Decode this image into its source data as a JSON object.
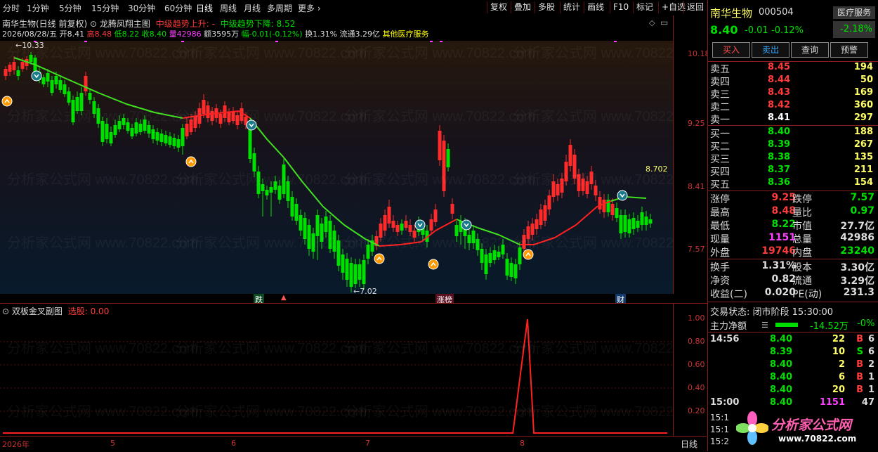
{
  "toolbar": {
    "left": [
      "分时",
      "1分钟",
      "5分钟",
      "15分钟",
      "30分钟",
      "60分钟",
      "日线",
      "周线",
      "月线",
      "多周期",
      "更多"
    ],
    "right": [
      "复权",
      "叠加",
      "多股",
      "统计",
      "画线",
      "F10",
      "标记",
      "+自选",
      "返回"
    ]
  },
  "header": {
    "line1": "南华生物(日线 前复权)",
    "indicator": "龙腾凤翔主图",
    "trend_up": "中级趋势上升: -",
    "trend_down": "中级趋势下降: 8.52",
    "line2_date": "2026/08/28/五",
    "line2_open": "开8.41",
    "line2_high": "高8.48",
    "line2_low": "低8.22",
    "line2_close": "收8.40",
    "line2_vol": "量42986",
    "line2_amt": "额3595万",
    "line2_chg": "幅-0.01(-0.12%)",
    "line2_turn": "换1.31%",
    "line2_float": "流通3.29亿",
    "line2_sector": "其他医疗服务"
  },
  "main_axis": [
    "10.18",
    "9.25",
    "8.41",
    "7.57"
  ],
  "annotations": {
    "high": "10.33",
    "low": "7.02",
    "last": "8.702"
  },
  "event_labels": [
    "跌",
    "涨榜",
    "财"
  ],
  "sub": {
    "title": "双板金叉副图",
    "param_label": "选股:",
    "param_value": "0.00",
    "axis": [
      "1.00",
      "0.80",
      "0.60",
      "0.40",
      "0.20"
    ]
  },
  "xaxis": {
    "labels": [
      "2026年",
      "5",
      "6",
      "7",
      "8"
    ],
    "period": "日线"
  },
  "chart_data": {
    "type": "line",
    "title": "",
    "series": [
      {
        "values": [
          0,
          0,
          0,
          0,
          0,
          0,
          0,
          0,
          0,
          0,
          0,
          0,
          0,
          0,
          0,
          0,
          0,
          0,
          0,
          0,
          0,
          0,
          0,
          0,
          0,
          0,
          0,
          0,
          0,
          0,
          0,
          0,
          0,
          0,
          0,
          0,
          0,
          0,
          0,
          0,
          0,
          0,
          0,
          0,
          0,
          0,
          0,
          0,
          0,
          0,
          0,
          0,
          0,
          0,
          0,
          0,
          0,
          0,
          0,
          0,
          0,
          0,
          0,
          0,
          0,
          0,
          0,
          0,
          0,
          0,
          0,
          0,
          0,
          0,
          0,
          1,
          0,
          0,
          0,
          0,
          0,
          0,
          0,
          0,
          0,
          0,
          0,
          0,
          0,
          0,
          0,
          0,
          0,
          0,
          0,
          0,
          0
        ]
      }
    ],
    "ylim": [
      0,
      1
    ]
  },
  "right": {
    "name": "南华生物",
    "code": "000504",
    "sector_badge": "医疗服务",
    "price": "8.40",
    "change": "-0.01",
    "pct": "-0.12%",
    "sector_pct": "-2.18%",
    "buttons": [
      "买入",
      "卖出",
      "查询",
      "预警"
    ],
    "asks": [
      [
        "卖五",
        "8.45",
        "194"
      ],
      [
        "卖四",
        "8.44",
        "50"
      ],
      [
        "卖三",
        "8.43",
        "169"
      ],
      [
        "卖二",
        "8.42",
        "360"
      ],
      [
        "卖一",
        "8.41",
        "297"
      ]
    ],
    "bids": [
      [
        "买一",
        "8.40",
        "188"
      ],
      [
        "买二",
        "8.39",
        "267"
      ],
      [
        "买三",
        "8.38",
        "135"
      ],
      [
        "买四",
        "8.37",
        "211"
      ],
      [
        "买五",
        "8.36",
        "154"
      ]
    ],
    "stats": [
      [
        "涨停",
        "9.25",
        "跌停",
        "7.57"
      ],
      [
        "最高",
        "8.48",
        "量比",
        "0.97"
      ],
      [
        "最低",
        "8.22",
        "市值",
        "27.7亿"
      ],
      [
        "现量",
        "1151",
        "总量",
        "42986"
      ],
      [
        "外盘",
        "19746",
        "内盘",
        "23240"
      ]
    ],
    "stats2": [
      [
        "换手",
        "1.31%",
        "股本",
        "3.30亿"
      ],
      [
        "净资",
        "0.82",
        "流通",
        "3.29亿"
      ],
      [
        "收益(二)",
        "0.020",
        "PE(动)",
        "231.3"
      ]
    ],
    "trade_state": "交易状态: 闭市阶段 15:30:00",
    "main_flow_label": "主力净额",
    "main_flow_value": "-14.52万",
    "main_flow_pct": "-0%",
    "ticks": [
      [
        "14:56",
        "8.40",
        "22",
        "B",
        "6"
      ],
      [
        "",
        "8.39",
        "10",
        "S",
        "6"
      ],
      [
        "",
        "8.40",
        "2",
        "B",
        "2"
      ],
      [
        "",
        "8.40",
        "6",
        "B",
        "1"
      ],
      [
        "",
        "8.40",
        "20",
        "B",
        "1"
      ],
      [
        "15:00",
        "8.40",
        "1151",
        "",
        "47"
      ]
    ],
    "clock_partial": [
      "15:1",
      "15:1",
      "15:2"
    ],
    "logo_text": "分析家公式网",
    "logo_url": "www.70822.com"
  },
  "watermark": "分析家公式网 www.70822.com"
}
